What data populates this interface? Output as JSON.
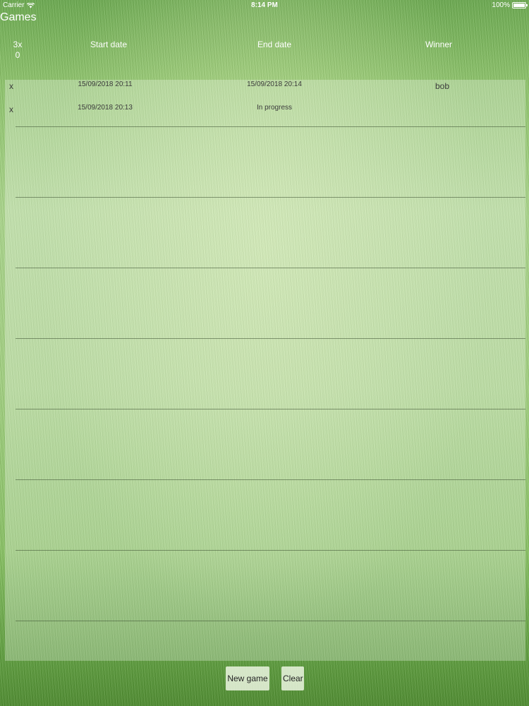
{
  "status_bar": {
    "carrier": "Carrier",
    "time": "8:14 PM",
    "battery": "100%"
  },
  "page": {
    "title": "Games"
  },
  "header": {
    "score_top": "3x",
    "score_bottom": "0",
    "start_date": "Start date",
    "end_date": "End date",
    "winner": "Winner"
  },
  "rows": [
    {
      "marker": "x",
      "start": "15/09/2018 20:11",
      "end": "15/09/2018 20:14",
      "winner": "bob"
    },
    {
      "marker": "x",
      "start": "15/09/2018 20:13",
      "end": "In progress",
      "winner": ""
    }
  ],
  "buttons": {
    "new_game": "New game",
    "clear": "Clear"
  }
}
